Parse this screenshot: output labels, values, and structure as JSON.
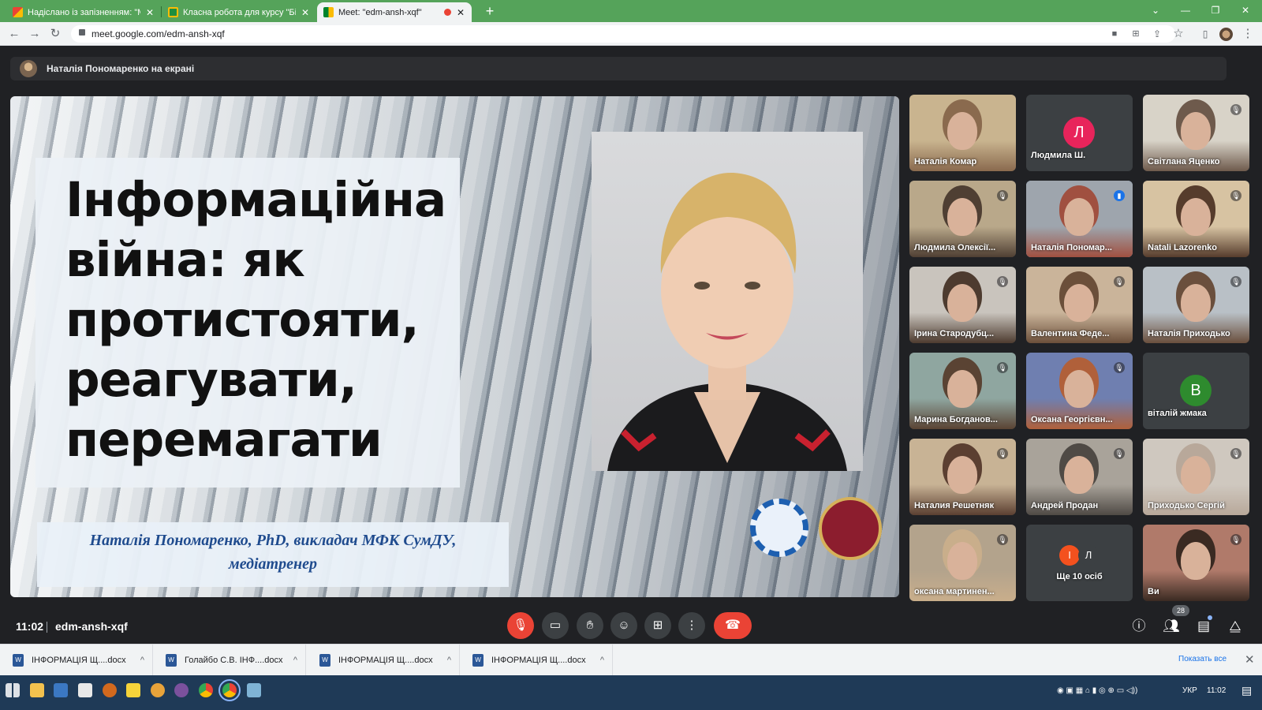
{
  "browser": {
    "tabs": [
      {
        "title": "Надіслано із запізненням: \"Мод",
        "favicon": "gmail-icon"
      },
      {
        "title": "Класна робота для курсу \"Біол",
        "favicon": "classroom-icon"
      },
      {
        "title": "Meet: \"edm-ansh-xqf\"",
        "favicon": "meet-icon",
        "recording": true
      }
    ],
    "url": "meet.google.com/edm-ansh-xqf"
  },
  "meet": {
    "presenter_banner": "Наталія Пономаренко на екрані",
    "slide": {
      "title_lines": [
        "Інформаційна",
        "війна: як",
        "протистояти,",
        "реагувати,",
        "перемагати"
      ],
      "subtitle_lines": [
        "Наталія Пономаренко, PhD, викладач МФК СумДУ,",
        "медіатренер"
      ]
    },
    "participants": [
      {
        "name": "Наталія Комар",
        "muted": false,
        "kind": "video"
      },
      {
        "name": "Людмила Ш.",
        "muted": false,
        "kind": "avatar",
        "initial": "Л",
        "color": "#e8245b"
      },
      {
        "name": "Світлана Яценко",
        "muted": true,
        "kind": "video"
      },
      {
        "name": "Людмила Олексії...",
        "muted": true,
        "kind": "video"
      },
      {
        "name": "Наталія Пономар...",
        "muted": false,
        "kind": "video",
        "speaking": true
      },
      {
        "name": "Natali Lazorenko",
        "muted": true,
        "kind": "video"
      },
      {
        "name": "Ірина Стародубц...",
        "muted": true,
        "kind": "video"
      },
      {
        "name": "Валентина Феде...",
        "muted": true,
        "kind": "video"
      },
      {
        "name": "Наталія Приходько",
        "muted": true,
        "kind": "video"
      },
      {
        "name": "Марина Богданов...",
        "muted": true,
        "kind": "video"
      },
      {
        "name": "Оксана Георгієвн...",
        "muted": true,
        "kind": "video"
      },
      {
        "name": "віталій жмака",
        "muted": false,
        "kind": "avatar",
        "initial": "В",
        "color": "#2e8b2e"
      },
      {
        "name": "Наталия Решетняк",
        "muted": true,
        "kind": "video"
      },
      {
        "name": "Андрей Продан",
        "muted": true,
        "kind": "video"
      },
      {
        "name": "Приходько Сергій",
        "muted": true,
        "kind": "video"
      },
      {
        "name": "оксана мартинен...",
        "muted": true,
        "kind": "video"
      },
      {
        "name": "Ще 10 осіб",
        "muted": false,
        "kind": "more",
        "initials": [
          "І",
          "Л"
        ]
      },
      {
        "name": "Ви",
        "muted": true,
        "kind": "video"
      }
    ],
    "time": "11:02",
    "meeting_code": "edm-ansh-xqf",
    "participant_count": "28"
  },
  "downloads": {
    "items": [
      "ІНФОРМАЦІЯ Щ....docx",
      "Голайбо С.В. ІНФ....docx",
      "ІНФОРМАЦІЯ Щ....docx",
      "ІНФОРМАЦІЯ Щ....docx"
    ],
    "show_all": "Показать все"
  },
  "taskbar": {
    "lang": "УКР",
    "time": "11:02"
  }
}
